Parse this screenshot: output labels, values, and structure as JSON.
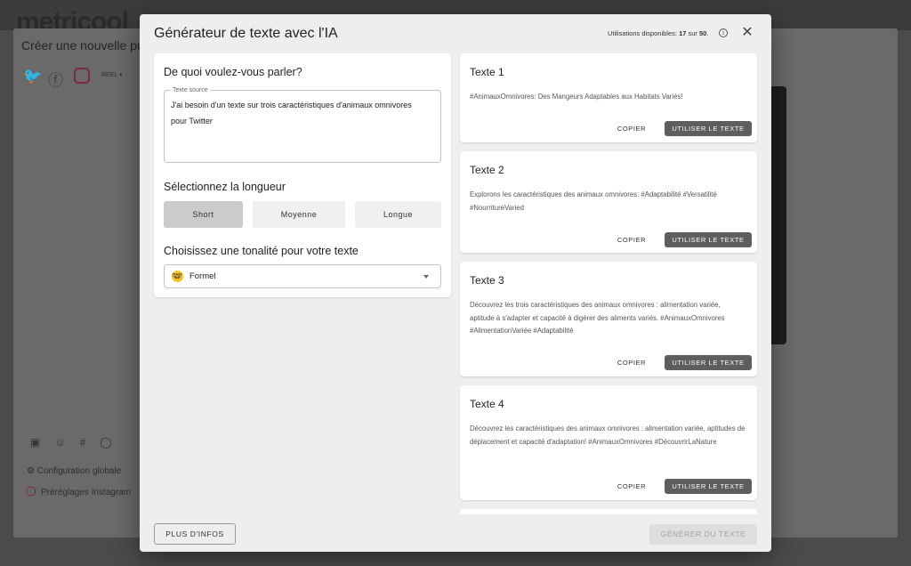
{
  "background": {
    "logo": "metricool",
    "card_title": "Créer une nouvelle publi",
    "format_label": "REEL",
    "config_label": "Configuration globale",
    "preset_label": "Préréglages Instagram"
  },
  "modal": {
    "title": "Générateur de texte avec l'IA",
    "usage_label": "Utilisations disponibles:",
    "usage_used": "17",
    "usage_sep": "sur",
    "usage_total": "50",
    "usage_dot": ".",
    "info_icon": "info-icon",
    "close_icon": "close-icon"
  },
  "form": {
    "topic_heading": "De quoi voulez-vous parler?",
    "source_legend": "Texte source",
    "source_text": "J'ai besoin d'un texte sur trois caractéristiques d'animaux omnivores pour Twitter",
    "length_heading": "Sélectionnez la longueur",
    "lengths": [
      {
        "label": "Short",
        "selected": true
      },
      {
        "label": "Moyenne",
        "selected": false
      },
      {
        "label": "Longue",
        "selected": false
      }
    ],
    "tone_heading": "Choisissez une tonalité pour votre texte",
    "tone_value": "Formel",
    "tone_emoji": "🤓"
  },
  "results": [
    {
      "title": "Texte 1",
      "body": "#AnimauxOmnivores: Des Mangeurs Adaptables aux Habitats Variés!"
    },
    {
      "title": "Texte 2",
      "body": "Explorons les caractéristiques des animaux omnivores: #Adaptabilité #Versatilité #NourritureVaried"
    },
    {
      "title": "Texte 3",
      "body": "Découvrez les trois caractéristiques des animaux omnivores : alimentation variée, aptitude à s'adapter et capacité à digérer des aliments variés. #AnimauxOmnivores #AlimentationVariée #Adaptabilité"
    },
    {
      "title": "Texte 4",
      "body": "Découvrez les caractéristiques des animaux omnivores : alimentation variée, aptitudes de déplacement et capacité d'adaptation! #AnimauxOmnivores #DécouvrirLaNature"
    }
  ],
  "actions": {
    "copy_label": "COPIER",
    "use_label": "UTILISER LE TEXTE",
    "more_info_label": "PLUS D'INFOS",
    "generate_label": "GÉNÉRER DU TEXTE"
  }
}
